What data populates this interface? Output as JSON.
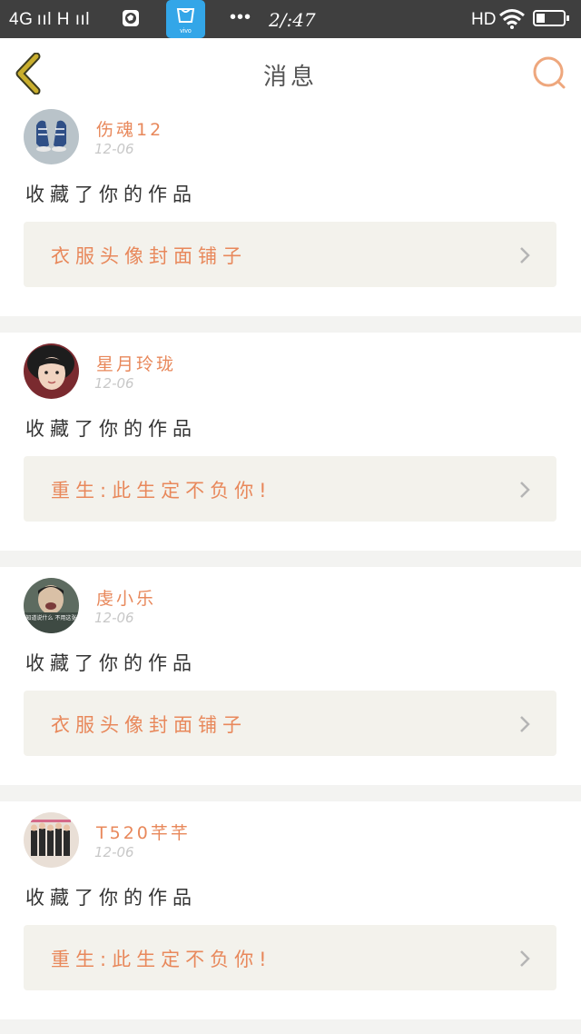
{
  "status_bar": {
    "signal": "4G ııl  H ııl",
    "time": "2/:47",
    "dots": "•••",
    "network": "HD",
    "app_label": "vivo"
  },
  "header": {
    "title": "消息"
  },
  "colors": {
    "accent": "#e8885b",
    "back_arrow": "#c9ae2d",
    "card_bg": "#f3f2ec"
  },
  "messages": [
    {
      "user": "伤魂12",
      "date": "12-06",
      "action": "收藏了你的作品",
      "work": "衣服头像封面铺子",
      "avatar": "shoes-avatar"
    },
    {
      "user": "星月玲珑",
      "date": "12-06",
      "action": "收藏了你的作品",
      "work": "重生:此生定不负你!",
      "avatar": "girl-avatar"
    },
    {
      "user": "虔小乐",
      "date": "12-06",
      "action": "收藏了你的作品",
      "work": "衣服头像封面铺子",
      "avatar": "meme-avatar",
      "avatar_text": "不知道说什么 不用这张图"
    },
    {
      "user": "T520芊芊",
      "date": "12-06",
      "action": "收藏了你的作品",
      "work": "重生:此生定不负你!",
      "avatar": "group-avatar"
    }
  ]
}
